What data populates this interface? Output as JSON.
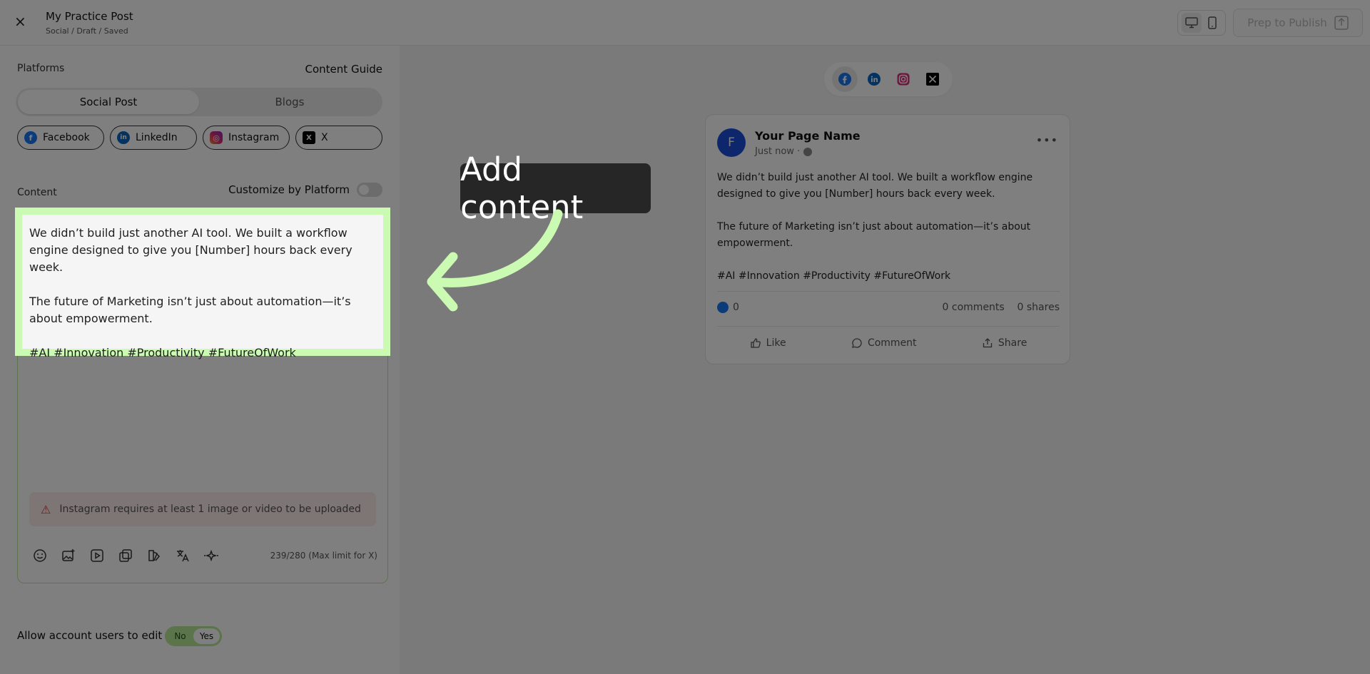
{
  "header": {
    "close_glyph": "×",
    "title": "My Practice Post",
    "breadcrumb": "Social / Draft / Saved",
    "publish_label": "Prep to Publish",
    "publish_icon": "export-icon"
  },
  "editor": {
    "platforms_label": "Platforms",
    "content_guide_label": "Content Guide",
    "tabs": [
      {
        "label": "Social Post",
        "active": true
      },
      {
        "label": "Blogs",
        "active": false
      }
    ],
    "platform_chips": [
      {
        "label": "Facebook",
        "icon": "f"
      },
      {
        "label": "LinkedIn",
        "icon": "in"
      },
      {
        "label": "Instagram",
        "icon": "◎"
      },
      {
        "label": "X",
        "icon": "X"
      }
    ],
    "content_label": "Content",
    "customize_label": "Customize by Platform",
    "post_paragraphs": [
      "We didn’t build just another AI tool. We built a workflow engine designed to give you [Number] hours back every week.",
      "The future of Marketing isn’t just about automation—it’s about empowerment.",
      "#AI #Innovation #Productivity #FutureOfWork"
    ],
    "warning_text": "Instagram requires at least 1 image or video to be uploaded",
    "tools": [
      "emoji-icon",
      "image-add-icon",
      "video-icon",
      "gallery-icon",
      "brand-icon",
      "translate-icon",
      "ai-sparkle-icon"
    ],
    "char_counter": "239/280 (Max limit for X)",
    "allow_edit_label": "Allow account users to edit",
    "allow_edit_options": [
      "No",
      "Yes"
    ],
    "allow_edit_selected": "Yes"
  },
  "preview": {
    "switch_icons": [
      "facebook",
      "linkedin",
      "instagram",
      "x"
    ],
    "avatar_letter": "F",
    "page_name": "Your Page Name",
    "time": "Just now ·",
    "more": "•••",
    "paragraphs": [
      "We didn’t build just another AI tool. We built a workflow engine designed to give you [Number] hours back every week.",
      "The future of Marketing isn’t just about automation—it’s about empowerment.",
      "#AI #Innovation #Productivity #FutureOfWork"
    ],
    "likes": "0",
    "comments": "0 comments",
    "shares": "0 shares",
    "actions": {
      "like": "Like",
      "comment": "Comment",
      "share": "Share"
    }
  },
  "overlay": {
    "tooltip": "Add content",
    "arrow_color": "#cbfbb2",
    "highlight_color": "#cbfbb2"
  },
  "colors": {
    "facebook": "#1877f2",
    "linkedin": "#0a66c2",
    "accent_green": "#b7e893",
    "warning_bg": "#fdeaea"
  }
}
